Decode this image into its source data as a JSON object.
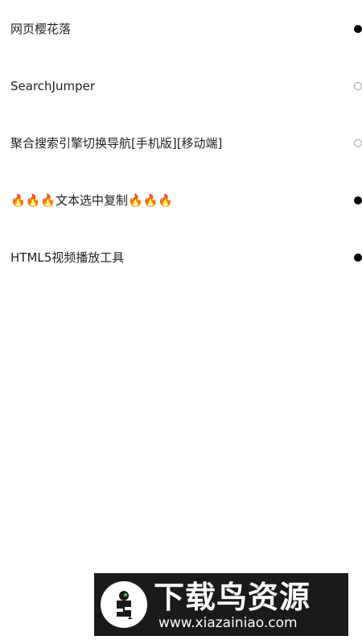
{
  "scripts": [
    {
      "name": "网页樱花落",
      "enabled": true
    },
    {
      "name": "SearchJumper",
      "enabled": false
    },
    {
      "name": "聚合搜索引擎切换导航[手机版][移动端]",
      "enabled": false
    },
    {
      "name": "🔥🔥🔥文本选中复制🔥🔥🔥",
      "enabled": true
    },
    {
      "name": "HTML5视频播放工具",
      "enabled": true
    }
  ],
  "watermark": {
    "title": "下载鸟资源",
    "url": "www.xiazainiao.com"
  },
  "colors": {
    "toggle_on": "#000000",
    "toggle_off_border": "#9a9a9a",
    "watermark_bg": "#1a1a1a",
    "watermark_accent": "#3cc96a"
  }
}
